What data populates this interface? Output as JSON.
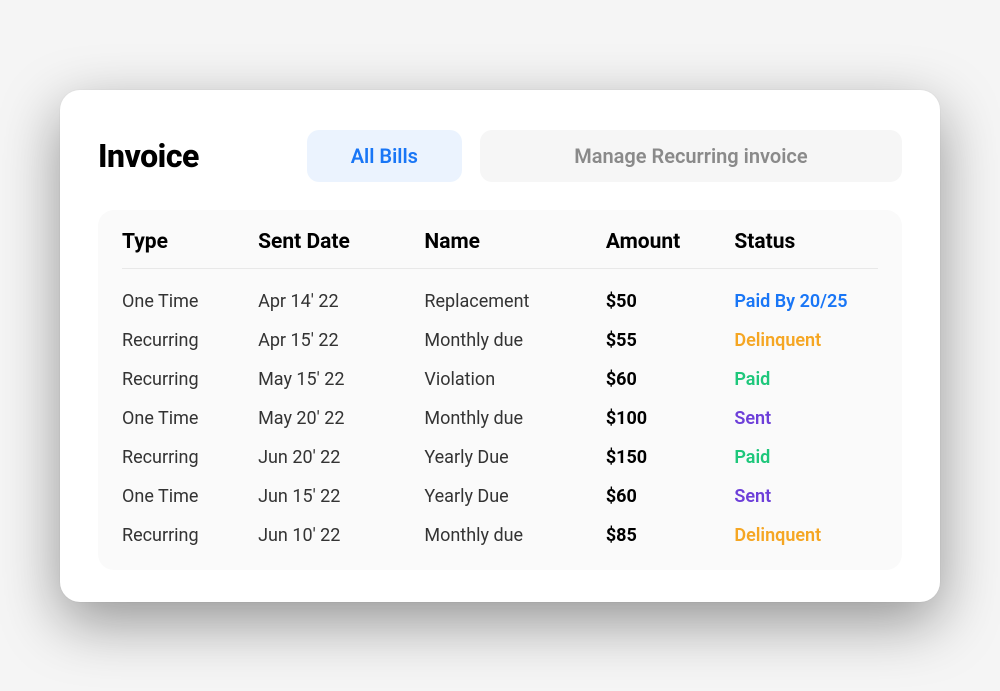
{
  "header": {
    "title": "Invoice",
    "tabs": {
      "all_bills": "All Bills",
      "manage_recurring": "Manage Recurring invoice"
    }
  },
  "table": {
    "columns": {
      "type": "Type",
      "sent_date": "Sent Date",
      "name": "Name",
      "amount": "Amount",
      "status": "Status"
    },
    "rows": [
      {
        "type": "One Time",
        "sent_date": "Apr 14' 22",
        "name": "Replacement",
        "amount": "$50",
        "status": "Paid By 20/25",
        "status_color": "blue"
      },
      {
        "type": "Recurring",
        "sent_date": "Apr 15' 22",
        "name": "Monthly due",
        "amount": "$55",
        "status": "Delinquent",
        "status_color": "orange"
      },
      {
        "type": "Recurring",
        "sent_date": "May 15' 22",
        "name": "Violation",
        "amount": "$60",
        "status": "Paid",
        "status_color": "green"
      },
      {
        "type": "One Time",
        "sent_date": "May 20' 22",
        "name": "Monthly due",
        "amount": "$100",
        "status": "Sent",
        "status_color": "purple"
      },
      {
        "type": "Recurring",
        "sent_date": "Jun 20' 22",
        "name": "Yearly Due",
        "amount": "$150",
        "status": "Paid",
        "status_color": "green"
      },
      {
        "type": "One Time",
        "sent_date": "Jun 15' 22",
        "name": "Yearly Due",
        "amount": "$60",
        "status": "Sent",
        "status_color": "purple"
      },
      {
        "type": "Recurring",
        "sent_date": "Jun 10' 22",
        "name": "Monthly due",
        "amount": "$85",
        "status": "Delinquent",
        "status_color": "orange"
      }
    ]
  }
}
